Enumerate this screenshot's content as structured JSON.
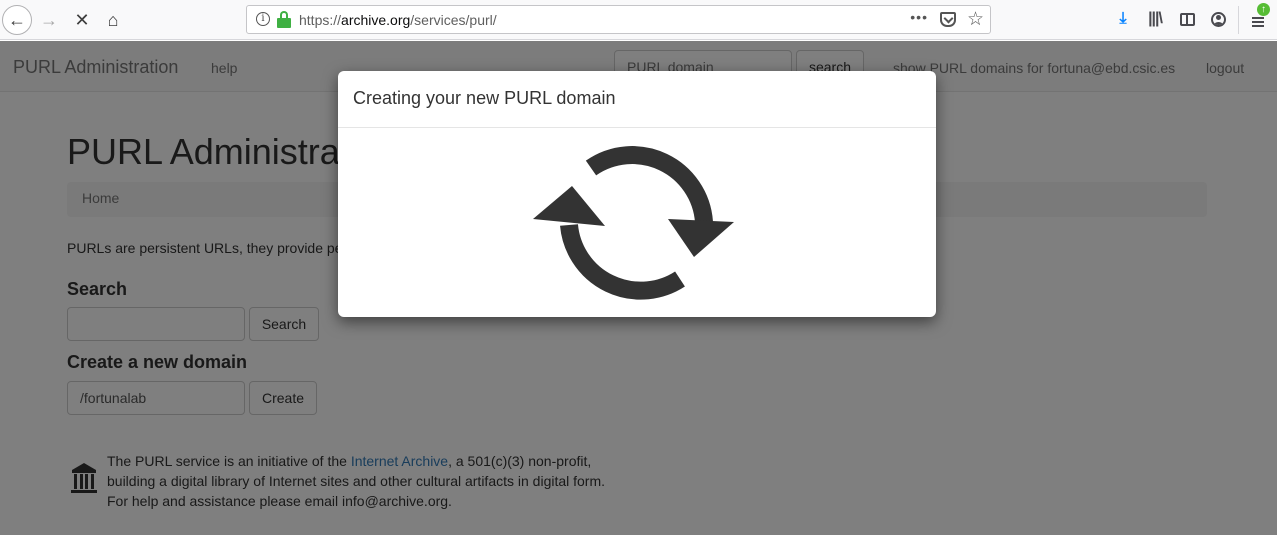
{
  "browser": {
    "url_prefix": "https://",
    "url_host": "archive.org",
    "url_path": "/services/purl/",
    "info_glyph": "i",
    "more_glyph": "•••",
    "star_glyph": "☆",
    "back_glyph": "←",
    "forward_glyph": "→",
    "stop_glyph": "✕",
    "home_glyph": "⌂",
    "download_glyph": "⤓",
    "library_glyph": "|||\\",
    "update_glyph": "↑"
  },
  "navbar": {
    "brand": "PURL Administration",
    "help": "help",
    "search_placeholder": "PURL domain",
    "search_button": "search",
    "domains_link": "show PURL domains for fortuna@ebd.csic.es",
    "logout": "logout"
  },
  "main": {
    "title": "PURL Administration",
    "breadcrumb": "Home",
    "intro": "PURLs are persistent URLs, they provide pe",
    "search_heading": "Search",
    "search_value": "",
    "search_button": "Search",
    "create_heading": "Create a new domain",
    "create_value": "/fortunalab",
    "create_button": "Create"
  },
  "footer": {
    "line1_before": "The PURL service is an initiative of the ",
    "link": "Internet Archive",
    "line1_after": ", a 501(c)(3) non-profit,",
    "line2": "building a digital library of Internet sites and other cultural artifacts in digital form.",
    "line3": "For help and assistance please email info@archive.org."
  },
  "modal": {
    "title": "Creating your new PURL domain",
    "spinner_icon": "refresh-icon",
    "spinner_color": "#333333"
  }
}
